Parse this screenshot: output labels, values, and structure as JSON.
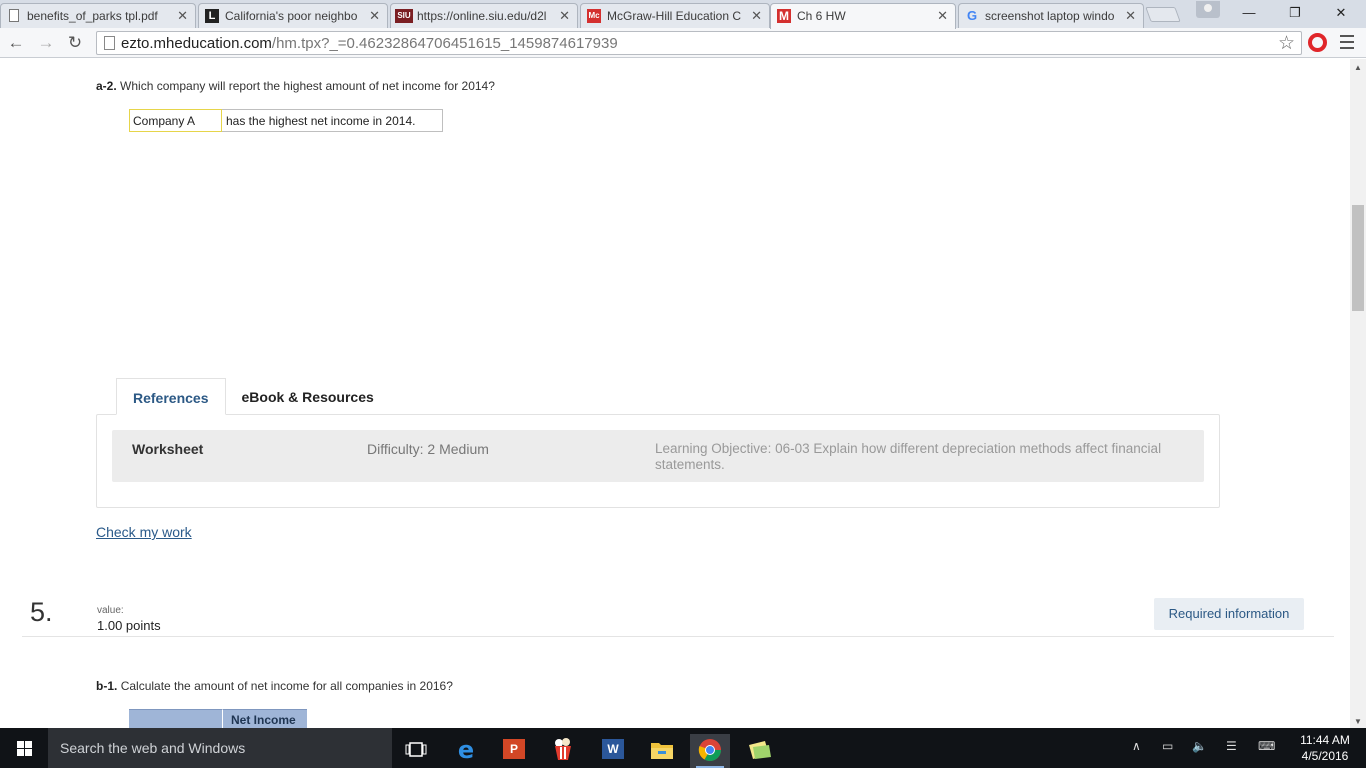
{
  "browser": {
    "tabs": [
      {
        "title": "benefits_of_parks tpl.pdf",
        "favicon": "document-icon",
        "active": false
      },
      {
        "title": "California's poor neighbo",
        "favicon": "L",
        "active": false
      },
      {
        "title": "https://online.siu.edu/d2l",
        "favicon": "SIU",
        "active": false
      },
      {
        "title": "McGraw-Hill Education C",
        "favicon": "Mc",
        "active": false
      },
      {
        "title": "Ch 6 HW",
        "favicon": "M",
        "active": true
      },
      {
        "title": "screenshot laptop windo",
        "favicon": "G",
        "active": false
      }
    ],
    "url_host": "ezto.mheducation.com",
    "url_rest": "/hm.tpx?_=0.46232864706451615_1459874617939"
  },
  "question_a2": {
    "label": "a-2.",
    "text": "Which company will report the highest amount of net income for 2014?",
    "selected_answer": "Company A",
    "answer_suffix": "has the highest net income in 2014."
  },
  "references": {
    "tabs": [
      "References",
      "eBook & Resources"
    ],
    "row": {
      "type": "Worksheet",
      "difficulty": "Difficulty: 2 Medium",
      "objective": "Learning Objective: 06-03 Explain how different depreciation methods affect financial statements."
    }
  },
  "check_link": "Check my work",
  "question5": {
    "number": "5.",
    "value_label": "value:",
    "value": "1.00 points",
    "required_button": "Required information"
  },
  "question_b1": {
    "label": "b-1.",
    "text": "Calculate the amount of net income for all companies in 2016?",
    "table_header": "Net Income"
  },
  "taskbar": {
    "search_placeholder": "Search the web and Windows",
    "time": "11:44 AM",
    "date": "4/5/2016"
  },
  "colors": {
    "link": "#2a5a8a",
    "active_tab_text": "#2c5985",
    "table_header_bg": "#9fb5d7",
    "taskbar_bg": "#101317"
  }
}
